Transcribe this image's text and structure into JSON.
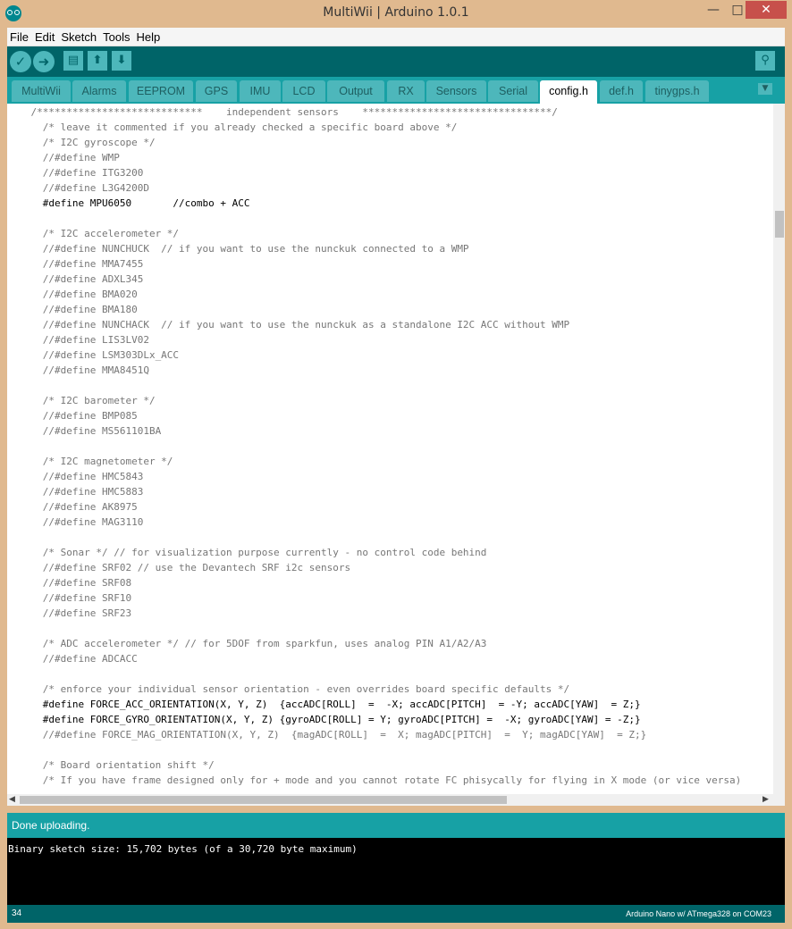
{
  "window": {
    "title": "MultiWii | Arduino 1.0.1",
    "minimize": "—",
    "maximize": "□",
    "close": "✕"
  },
  "menu": [
    "File",
    "Edit",
    "Sketch",
    "Tools",
    "Help"
  ],
  "toolbar": {
    "verify_icon": "check-icon",
    "upload_icon": "arrow-right-icon",
    "new_icon": "new-document-icon",
    "open_icon": "open-arrow-up-icon",
    "save_icon": "save-arrow-down-icon",
    "monitor_icon": "serial-monitor-icon",
    "verify_glyph": "✓",
    "upload_glyph": "➜",
    "new_glyph": "▤",
    "open_glyph": "⬆",
    "save_glyph": "⬇",
    "monitor_glyph": "⚲"
  },
  "tabs": [
    "MultiWii",
    "Alarms",
    "EEPROM",
    "GPS",
    "IMU",
    "LCD",
    "Output",
    "RX",
    "Sensors",
    "Serial",
    "config.h",
    "def.h",
    "tinygps.h"
  ],
  "active_tab": "config.h",
  "tab_menu_glyph": "▼",
  "code_lines": [
    "    /****************************    independent sensors    ********************************/",
    "      /* leave it commented if you already checked a specific board above */",
    "      /* I2C gyroscope */",
    "      //#define WMP",
    "      //#define ITG3200",
    "      //#define L3G4200D",
    "      #define MPU6050       //combo + ACC",
    "",
    "      /* I2C accelerometer */",
    "      //#define NUNCHUCK  // if you want to use the nunckuk connected to a WMP",
    "      //#define MMA7455",
    "      //#define ADXL345",
    "      //#define BMA020",
    "      //#define BMA180",
    "      //#define NUNCHACK  // if you want to use the nunckuk as a standalone I2C ACC without WMP",
    "      //#define LIS3LV02",
    "      //#define LSM303DLx_ACC",
    "      //#define MMA8451Q",
    "",
    "      /* I2C barometer */",
    "      //#define BMP085",
    "      //#define MS561101BA",
    "",
    "      /* I2C magnetometer */",
    "      //#define HMC5843",
    "      //#define HMC5883",
    "      //#define AK8975",
    "      //#define MAG3110",
    "",
    "      /* Sonar */ // for visualization purpose currently - no control code behind",
    "      //#define SRF02 // use the Devantech SRF i2c sensors",
    "      //#define SRF08",
    "      //#define SRF10",
    "      //#define SRF23",
    "",
    "      /* ADC accelerometer */ // for 5DOF from sparkfun, uses analog PIN A1/A2/A3",
    "      //#define ADCACC",
    "",
    "      /* enforce your individual sensor orientation - even overrides board specific defaults */",
    "      #define FORCE_ACC_ORIENTATION(X, Y, Z)  {accADC[ROLL]  =  -X; accADC[PITCH]  = -Y; accADC[YAW]  = Z;}",
    "      #define FORCE_GYRO_ORIENTATION(X, Y, Z) {gyroADC[ROLL] = Y; gyroADC[PITCH] =  -X; gyroADC[YAW] = -Z;}",
    "      //#define FORCE_MAG_ORIENTATION(X, Y, Z)  {magADC[ROLL]  =  X; magADC[PITCH]  =  Y; magADC[YAW]  = Z;}",
    "",
    "      /* Board orientation shift */",
    "      /* If you have frame designed only for + mode and you cannot rotate FC phisycally for flying in X mode (or vice versa)"
  ],
  "active_lines": [
    6,
    39,
    40
  ],
  "status": "Done uploading.",
  "console": "Binary sketch size: 15,702 bytes (of a 30,720 byte maximum)",
  "footer": {
    "line": "34",
    "board": "Arduino Nano w/ ATmega328 on COM23"
  }
}
